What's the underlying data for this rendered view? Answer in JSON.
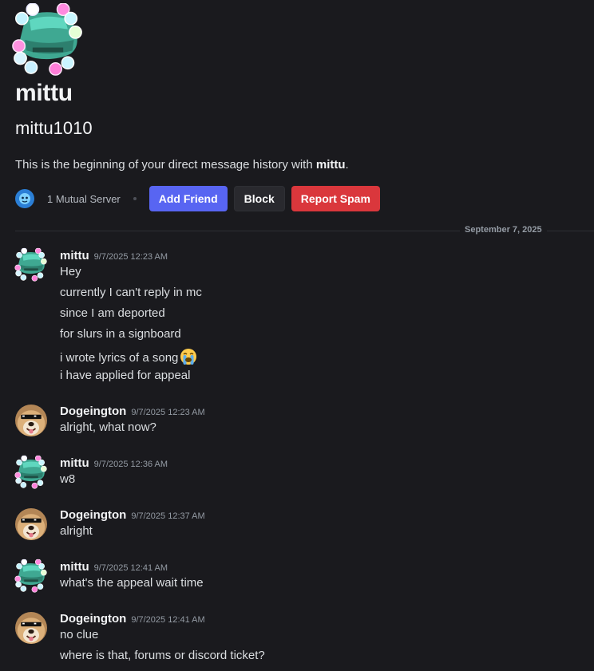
{
  "profile": {
    "display_name": "mittu",
    "username": "mittu1010",
    "intro_prefix": "This is the beginning of your direct message history with ",
    "intro_name": "mittu",
    "intro_suffix": ".",
    "mutual_servers": "1 Mutual Server",
    "add_friend": "Add Friend",
    "block": "Block",
    "report_spam": "Report Spam"
  },
  "divider": {
    "date": "September 7, 2025"
  },
  "messages": [
    {
      "author": "mittu",
      "time": "9/7/2025 12:23 AM",
      "avatar": "car-avatar",
      "lines": [
        "Hey",
        "currently I can't reply in mc",
        "since I am deported",
        "for slurs in a signboard",
        "i wrote lyrics of a song",
        "i have applied for appeal"
      ],
      "emoji": "loudly-crying-face-emoji"
    },
    {
      "author": "Dogeington",
      "time": "9/7/2025 12:23 AM",
      "avatar": "doge-avatar",
      "lines": [
        "alright, what now?"
      ]
    },
    {
      "author": "mittu",
      "time": "9/7/2025 12:36 AM",
      "avatar": "car-avatar",
      "lines": [
        "w8"
      ]
    },
    {
      "author": "Dogeington",
      "time": "9/7/2025 12:37 AM",
      "avatar": "doge-avatar",
      "lines": [
        "alright"
      ]
    },
    {
      "author": "mittu",
      "time": "9/7/2025 12:41 AM",
      "avatar": "car-avatar",
      "lines": [
        "what's the appeal wait time"
      ]
    },
    {
      "author": "Dogeington",
      "time": "9/7/2025 12:41 AM",
      "avatar": "doge-avatar",
      "lines": [
        "no clue",
        "where is that, forums or discord ticket?"
      ]
    }
  ],
  "colors": {
    "background": "#1a1a1e",
    "accent": "#5865f2",
    "danger": "#da373c"
  }
}
